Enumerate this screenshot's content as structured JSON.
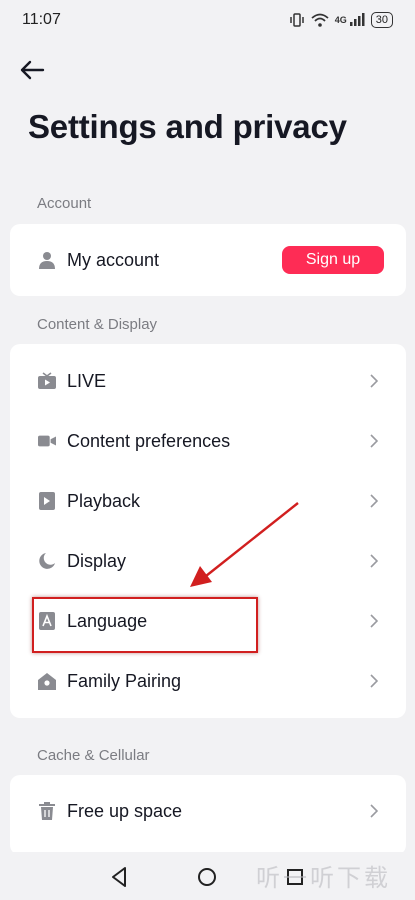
{
  "status_bar": {
    "time": "11:07",
    "network": "4G",
    "battery": "30"
  },
  "page": {
    "title": "Settings and privacy"
  },
  "sections": [
    {
      "header": "Account",
      "items": [
        {
          "label": "My account",
          "icon": "person-icon",
          "action": "Sign up"
        }
      ]
    },
    {
      "header": "Content & Display",
      "items": [
        {
          "label": "LIVE",
          "icon": "tv-icon"
        },
        {
          "label": "Content preferences",
          "icon": "video-camera-icon"
        },
        {
          "label": "Playback",
          "icon": "play-icon"
        },
        {
          "label": "Display",
          "icon": "moon-icon"
        },
        {
          "label": "Language",
          "icon": "language-icon"
        },
        {
          "label": "Family Pairing",
          "icon": "home-icon"
        }
      ]
    },
    {
      "header": "Cache & Cellular",
      "items": [
        {
          "label": "Free up space",
          "icon": "trash-icon"
        }
      ]
    }
  ],
  "colors": {
    "accent": "#fe2c55",
    "annotation": "#d11f1f",
    "background": "#f2f2f4"
  },
  "watermark": "听一听下载"
}
